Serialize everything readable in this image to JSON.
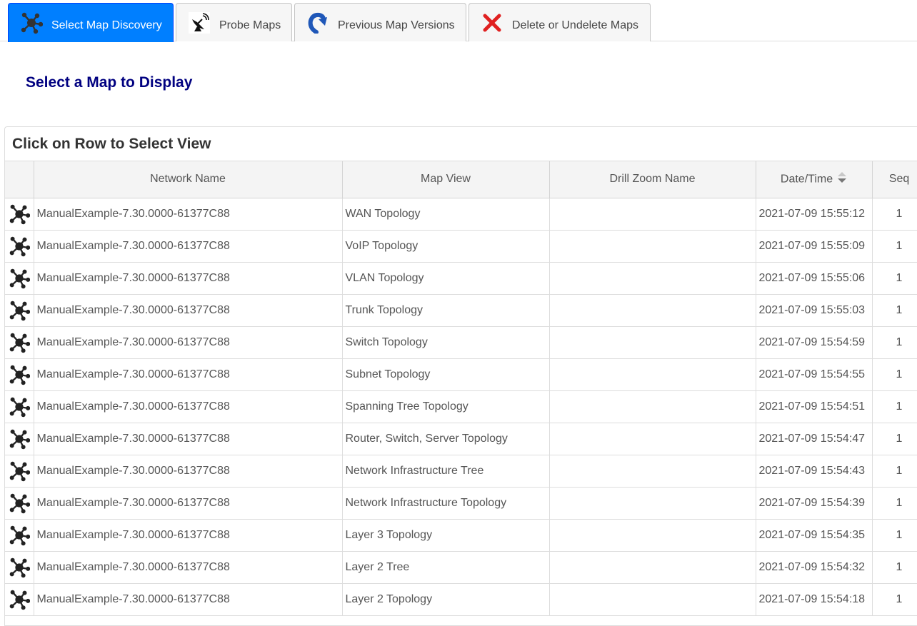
{
  "tabs": [
    {
      "label": "Select Map Discovery",
      "icon": "network-map-icon",
      "active": true
    },
    {
      "label": "Probe Maps",
      "icon": "satellite-dish-icon",
      "active": false
    },
    {
      "label": "Previous Map Versions",
      "icon": "undo-arrow-icon",
      "active": false
    },
    {
      "label": "Delete or Undelete Maps",
      "icon": "red-x-icon",
      "active": false
    }
  ],
  "page": {
    "title": "Select a Map to Display"
  },
  "table": {
    "caption": "Click on Row to Select View",
    "columns": [
      "",
      "Network Name",
      "Map View",
      "Drill Zoom Name",
      "Date/Time",
      "Seq"
    ],
    "sort_column": "Date/Time",
    "rows": [
      {
        "network": "ManualExample-7.30.0000-61377C88",
        "view": "WAN Topology",
        "drill": "",
        "datetime": "2021-07-09 15:55:12",
        "seq": "1"
      },
      {
        "network": "ManualExample-7.30.0000-61377C88",
        "view": "VoIP Topology",
        "drill": "",
        "datetime": "2021-07-09 15:55:09",
        "seq": "1"
      },
      {
        "network": "ManualExample-7.30.0000-61377C88",
        "view": "VLAN Topology",
        "drill": "",
        "datetime": "2021-07-09 15:55:06",
        "seq": "1"
      },
      {
        "network": "ManualExample-7.30.0000-61377C88",
        "view": "Trunk Topology",
        "drill": "",
        "datetime": "2021-07-09 15:55:03",
        "seq": "1"
      },
      {
        "network": "ManualExample-7.30.0000-61377C88",
        "view": "Switch Topology",
        "drill": "",
        "datetime": "2021-07-09 15:54:59",
        "seq": "1"
      },
      {
        "network": "ManualExample-7.30.0000-61377C88",
        "view": "Subnet Topology",
        "drill": "",
        "datetime": "2021-07-09 15:54:55",
        "seq": "1"
      },
      {
        "network": "ManualExample-7.30.0000-61377C88",
        "view": "Spanning Tree Topology",
        "drill": "",
        "datetime": "2021-07-09 15:54:51",
        "seq": "1"
      },
      {
        "network": "ManualExample-7.30.0000-61377C88",
        "view": "Router, Switch, Server Topology",
        "drill": "",
        "datetime": "2021-07-09 15:54:47",
        "seq": "1"
      },
      {
        "network": "ManualExample-7.30.0000-61377C88",
        "view": "Network Infrastructure Tree",
        "drill": "",
        "datetime": "2021-07-09 15:54:43",
        "seq": "1"
      },
      {
        "network": "ManualExample-7.30.0000-61377C88",
        "view": "Network Infrastructure Topology",
        "drill": "",
        "datetime": "2021-07-09 15:54:39",
        "seq": "1"
      },
      {
        "network": "ManualExample-7.30.0000-61377C88",
        "view": "Layer 3 Topology",
        "drill": "",
        "datetime": "2021-07-09 15:54:35",
        "seq": "1"
      },
      {
        "network": "ManualExample-7.30.0000-61377C88",
        "view": "Layer 2 Tree",
        "drill": "",
        "datetime": "2021-07-09 15:54:32",
        "seq": "1"
      },
      {
        "network": "ManualExample-7.30.0000-61377C88",
        "view": "Layer 2 Topology",
        "drill": "",
        "datetime": "2021-07-09 15:54:18",
        "seq": "1"
      }
    ]
  },
  "colors": {
    "active_tab": "#007fff",
    "title": "#000080",
    "delete_icon": "#e02020",
    "undo_icon": "#1f57b8"
  }
}
